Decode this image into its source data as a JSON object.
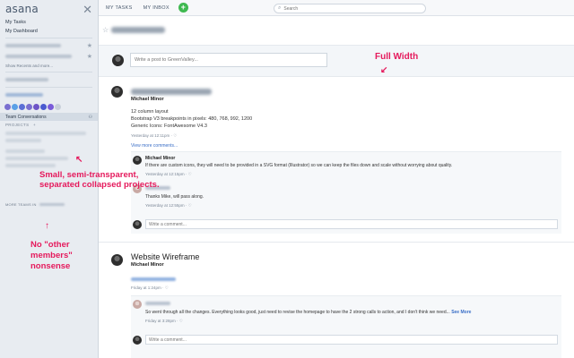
{
  "sidebar": {
    "logo": "asana",
    "close": "✕",
    "links": [
      "My Tasks",
      "My Dashboard"
    ],
    "show_recent": "Show Recents and more...",
    "team_conversations": "Team Conversations",
    "projects_header": "PROJECTS",
    "more_teams": "MORE TEAMS IN",
    "avatar_colors": [
      "#7a6fd0",
      "#5aa0e6",
      "#5b6fd6",
      "#7a6fd0",
      "#6e55c7",
      "#4a5ad0",
      "#7a5cd9",
      "#c8d0da"
    ]
  },
  "topbar": {
    "my_tasks": "MY TASKS",
    "my_inbox": "MY INBOX",
    "plus": "+",
    "search_placeholder": "Search"
  },
  "main": {
    "composer_placeholder": "Write a post to GreenValley...",
    "post1": {
      "author": "Michael Minor",
      "lines": [
        "12 column layout",
        "Bootstrap V3 breakpoints in pixels: 480, 768, 992, 1200",
        "Generic Icons: FontAwesome V4.3"
      ],
      "meta": "Yesterday at 12:11pm  ·  ♡",
      "view_more": "View more comments...",
      "comment1": {
        "author": "Michael Minor",
        "text": "If there are custom icons, they will need to be provided in a SVG format (Illustrator) so we can keep the files down and scale without worrying about quality.",
        "meta": "Yesterday at 12:15pm  ·  ♡"
      },
      "comment2": {
        "text": "Thanks Mike, will pass along.",
        "meta": "Yesterday at 12:55pm  ·  ♡"
      },
      "write_comment": "Write a comment..."
    },
    "post2": {
      "title": "Website Wireframe",
      "author": "Michael Minor",
      "meta": "Friday at 1:24pm  ·  ♡",
      "comment1": {
        "text": "So went through all the changes. Everything looks good, just need to revise the homepage to have the 2 strong calls to action, and I don't think we need...",
        "see_more": "See More",
        "meta": "Friday at 3:28pm  ·  ♡"
      },
      "write_comment": "Write a comment..."
    }
  },
  "annotations": {
    "full_width": "Full Width",
    "collapsed": [
      "Small, semi-transparent,",
      "separated collapsed projects."
    ],
    "no_other": [
      "No \"other",
      "members\"",
      "nonsense"
    ]
  }
}
